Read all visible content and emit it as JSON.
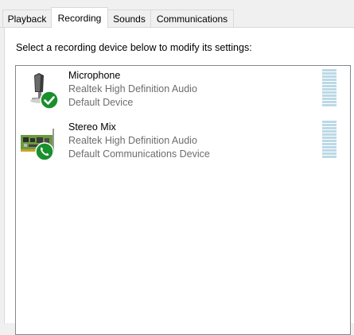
{
  "tabs": [
    {
      "label": "Playback",
      "active": false
    },
    {
      "label": "Recording",
      "active": true
    },
    {
      "label": "Sounds",
      "active": false
    },
    {
      "label": "Communications",
      "active": false
    }
  ],
  "instruction": "Select a recording device below to modify its settings:",
  "devices": [
    {
      "name": "Microphone",
      "driver": "Realtek High Definition Audio",
      "status": "Default Device",
      "icon": "microphone-icon",
      "badge": "green-checkmark-badge",
      "level": 0
    },
    {
      "name": "Stereo Mix",
      "driver": "Realtek High Definition Audio",
      "status": "Default Communications Device",
      "icon": "sound-card-icon",
      "badge": "green-phone-badge",
      "level": 0
    }
  ],
  "colors": {
    "badge_green": "#1a8f2d",
    "meter_bar": "#bcd9e6",
    "secondary_text": "#6d6d6d"
  }
}
